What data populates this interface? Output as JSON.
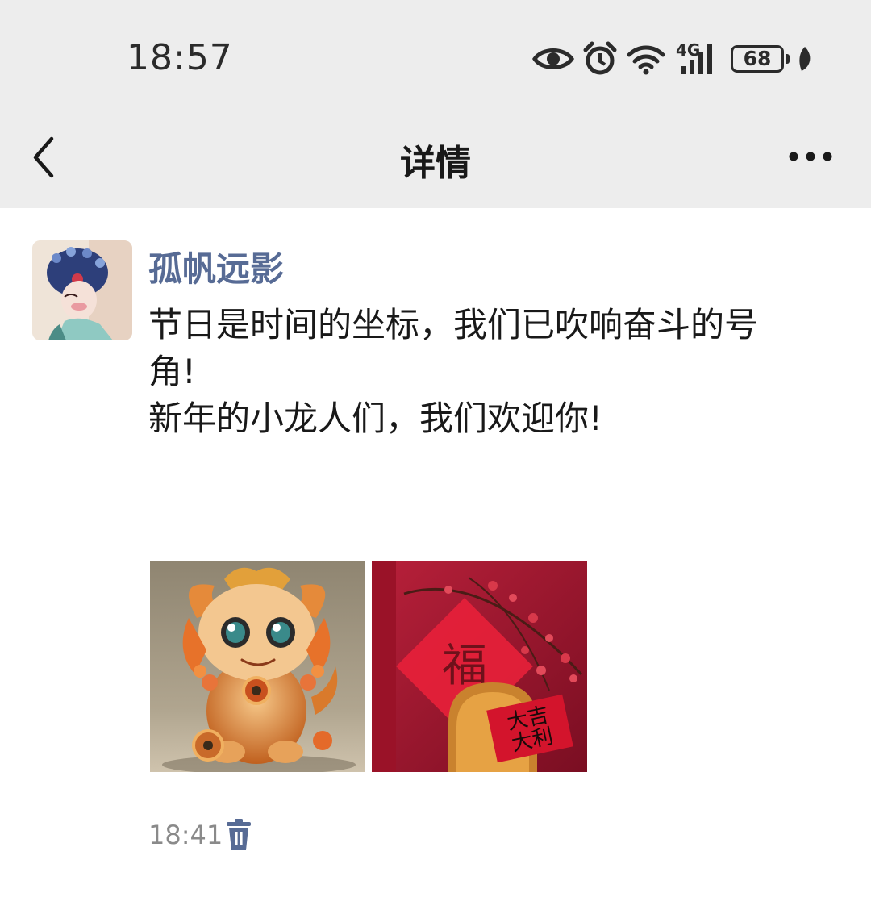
{
  "status_bar": {
    "time": "18:57",
    "network": "4G",
    "battery": "68",
    "icons": [
      "eye-icon",
      "alarm-icon",
      "wifi-icon",
      "signal-icon",
      "battery-icon",
      "leaf-icon"
    ]
  },
  "nav": {
    "title": "详情",
    "back_icon": "chevron-left-icon",
    "more_icon": "more-horizontal-icon"
  },
  "post": {
    "author": "孤帆远影",
    "text_lines": [
      "节日是时间的坐标，我们已吹响奋斗的号",
      "角!",
      "新年的小龙人们，我们欢迎你!"
    ],
    "photos": [
      "dragon-figurine-photo",
      "red-envelope-plum-blossom-photo"
    ],
    "photo_text": {
      "fu": "福",
      "envelope_line1": "大吉",
      "envelope_line2": "大利"
    },
    "time": "18:41",
    "delete_icon": "trash-icon"
  },
  "colors": {
    "header_bg": "#ededed",
    "username": "#576b95",
    "text": "#191919",
    "meta": "#8a8a8a"
  }
}
